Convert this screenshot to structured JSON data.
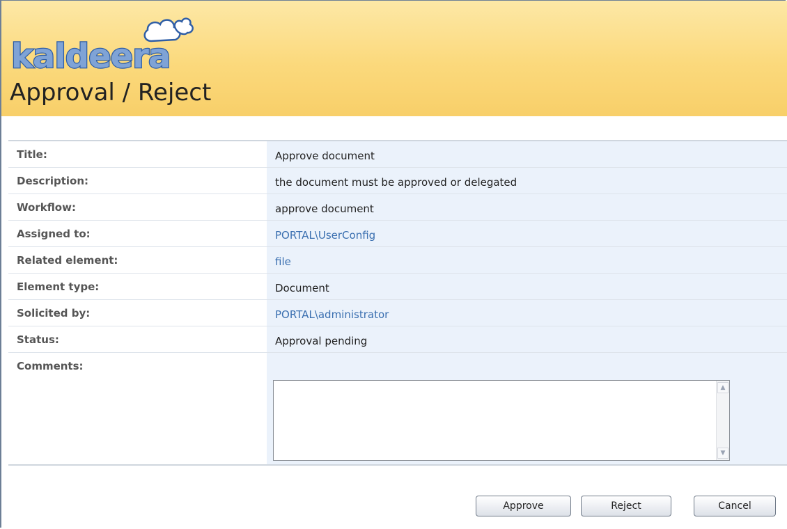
{
  "header": {
    "logo_text": "kaldeera",
    "page_title": "Approval / Reject"
  },
  "fields": [
    {
      "label": "Title:",
      "value": "Approve document",
      "is_link": false
    },
    {
      "label": "Description:",
      "value": "the document must be approved or delegated",
      "is_link": false
    },
    {
      "label": "Workflow:",
      "value": "approve document",
      "is_link": false
    },
    {
      "label": "Assigned to:",
      "value": "PORTAL\\UserConfig",
      "is_link": true
    },
    {
      "label": "Related element:",
      "value": "file",
      "is_link": true
    },
    {
      "label": "Element type:",
      "value": "Document",
      "is_link": false
    },
    {
      "label": "Solicited by:",
      "value": "PORTAL\\administrator",
      "is_link": true
    },
    {
      "label": "Status:",
      "value": "Approval pending",
      "is_link": false
    }
  ],
  "comments": {
    "label": "Comments:",
    "value": ""
  },
  "buttons": {
    "approve": "Approve",
    "reject": "Reject",
    "cancel": "Cancel"
  },
  "colors": {
    "header_gradient_top": "#fde8a6",
    "header_gradient_bottom": "#f8cf69",
    "value_cell_bg": "#ebf2fb",
    "link": "#3a6fb0",
    "logo_fill": "#7fa3d6",
    "logo_stroke": "#2f5ea6"
  }
}
